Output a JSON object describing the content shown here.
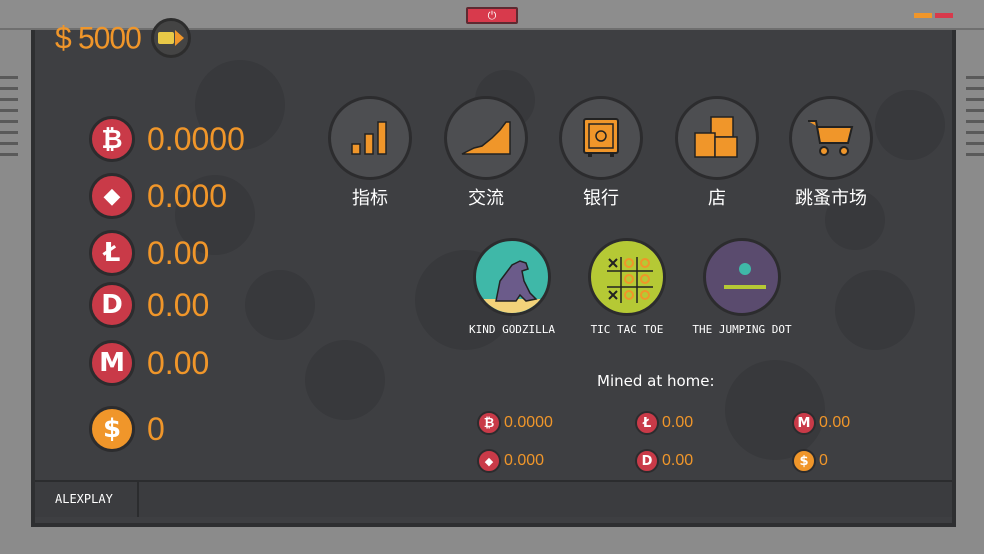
{
  "window": {
    "power_symbol": "⏻"
  },
  "header": {
    "money": "$ 5000",
    "add_money_icon": "cash-arrow-icon"
  },
  "wallet": [
    {
      "symbol": "₿",
      "icon": "bitcoin-icon",
      "value": "0.0000",
      "color": "#c93a48"
    },
    {
      "symbol": "◆",
      "icon": "ethereum-icon",
      "value": "0.000",
      "color": "#c93a48"
    },
    {
      "symbol": "Ł",
      "icon": "litecoin-icon",
      "value": "0.00",
      "color": "#c93a48"
    },
    {
      "symbol": "D",
      "icon": "dash-icon",
      "value": "0.00",
      "color": "#c93a48"
    },
    {
      "symbol": "M",
      "icon": "monero-icon",
      "value": "0.00",
      "color": "#c93a48"
    },
    {
      "symbol": "$",
      "icon": "dollar-icon",
      "value": "0",
      "color": "#f0962a"
    }
  ],
  "apps": [
    {
      "label": "指标",
      "icon": "bar-chart-icon"
    },
    {
      "label": "交流",
      "icon": "area-chart-icon"
    },
    {
      "label": "银行",
      "icon": "safe-icon"
    },
    {
      "label": "店",
      "icon": "boxes-icon"
    },
    {
      "label": "跳蚤市场",
      "icon": "shopping-cart-icon"
    }
  ],
  "games": [
    {
      "label": "KIND GODZILLA",
      "icon": "godzilla-icon"
    },
    {
      "label": "TIC TAC TOE",
      "icon": "tic-tac-toe-icon"
    },
    {
      "label": "THE JUMPING DOT",
      "icon": "jumping-dot-icon"
    }
  ],
  "mined": {
    "title": "Mined at home:",
    "items": [
      {
        "symbol": "₿",
        "icon": "bitcoin-icon",
        "value": "0.0000"
      },
      {
        "symbol": "Ł",
        "icon": "litecoin-icon",
        "value": "0.00"
      },
      {
        "symbol": "M",
        "icon": "monero-icon",
        "value": "0.00"
      },
      {
        "symbol": "◆",
        "icon": "ethereum-icon",
        "value": "0.000"
      },
      {
        "symbol": "D",
        "icon": "dash-icon",
        "value": "0.00"
      },
      {
        "symbol": "$",
        "icon": "dollar-icon",
        "value": "0"
      }
    ]
  },
  "taskbar": {
    "user": "ALEXPLAY"
  },
  "colors": {
    "accent": "#f0962a",
    "coin_red": "#c93a48",
    "screen": "#3e3f42"
  }
}
